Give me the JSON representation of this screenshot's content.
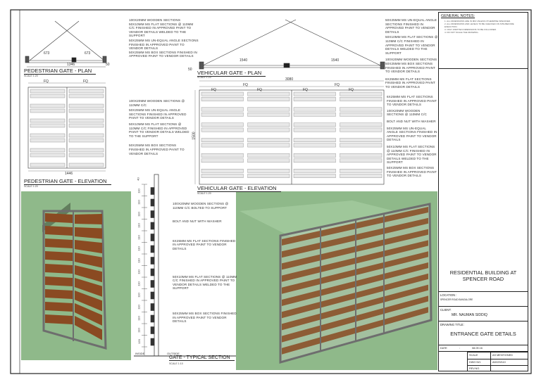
{
  "views": {
    "ped_plan": {
      "title": "PEDESTRIAN GATE - PLAN",
      "scale": "SCALE 1:20",
      "dims": [
        "673",
        "673",
        "1346",
        "50"
      ]
    },
    "veh_plan": {
      "title": "VEHICULAR GATE - PLAN",
      "scale": "SCALE 1:20",
      "dims": [
        "1540",
        "1540",
        "50"
      ]
    },
    "ped_elev": {
      "title": "PEDESTRIAN GATE - ELEVATION",
      "scale": "SCALE 1:20",
      "dims": [
        "FQ",
        "FQ",
        "1446"
      ]
    },
    "veh_elev": {
      "title": "VEHICULAR GATE - ELEVATION",
      "scale": "SCALE 1:20",
      "dims": [
        "3080",
        "FQ",
        "FQ",
        "FQ",
        "FQ",
        "FQ",
        "FQ",
        "1500"
      ]
    },
    "section": {
      "title": "GATE - TYPICAL SECTION",
      "scale": "SCALE 1:10",
      "inside": "INSIDE",
      "outside": "OUTSIDE",
      "dims": [
        "40",
        "110",
        "110",
        "110",
        "110",
        "110",
        "110",
        "110",
        "110",
        "110",
        "110",
        "110",
        "110",
        "110",
        "120"
      ]
    }
  },
  "notes": {
    "ped_plan": [
      "100X20MM WOODEN SECTIONS",
      "50X10MM MS FLAT SECTIONS @ 110MM C/C FINISHED IN APPROVED PAINT TO VENDOR DETAILS WELDED TO THE SUPPORT",
      "50X25MM MS UN-EQUAL ANGLE SECTIONS FINISHED IN APPROVED PAINT TO VENDOR DETAILS",
      "50X25MM MS BOX SECTIONS FINISHED IN APPROVED PAINT TO VENDOR DETAILS"
    ],
    "veh_plan": [
      "50X25MM MS UN-EQUAL ANGLE SECTIONS FINISHED IN APPROVED PAINT TO VENDOR DETAILS",
      "50X10MM MS FLAT SECTIONS @ 110MM C/C FINISHED IN APPROVED PAINT TO VENDOR DETAILS WELDED TO THE SUPPORT",
      "100X20MM WOODEN SECTIONS",
      "50X25MM MS BOX SECTIONS FINISHED IN APPROVED PAINT TO VENDOR DETAILS",
      "6X25MM MS FLAT SECTIONS FINISHED IN APPROVED PAINT TO VENDOR DETAILS"
    ],
    "ped_elev": [
      "100X20MM WOODEN SECTIONS @ 110MM C/C",
      "50X25MM MS UN-EQUAL ANGLE SECTIONS FINISHED IN APPROVED PAINT TO VENDOR DETAILS",
      "50X10MM MS FLAT SECTIONS @ 110MM C/C FINISHED IN APPROVED PAINT TO VENDOR DETAILS WELDED TO THE SUPPORT",
      "50X25MM MS BOX SECTIONS FINISHED IN APPROVED PAINT TO VENDOR DETAILS"
    ],
    "veh_elev": [
      "6X25MM MS FLAT SECTIONS FINISHED IN APPROVED PAINT TO VENDOR DETAILS",
      "100X20MM WOODEN SECTIONS @ 110MM C/C",
      "BOLT AND NUT WITH WASHER",
      "50X25MM MS UN-EQUAL ANGLE SECTIONS FINISHED IN APPROVED PAINT TO VENDOR DETAILS",
      "50X10MM MS FLAT SECTIONS @ 110MM C/C FINISHED IN APPROVED PAINT TO VENDOR DETAILS WELDED TO THE SUPPORT",
      "50X25MM MS BOX SECTIONS FINISHED IN APPROVED PAINT TO VENDOR DETAILS"
    ],
    "section": [
      "100X20MM WOODEN SECTIONS @ 110MM C/C BOLTED TO SUPPORT",
      "BOLT AND NUT WITH WASHER",
      "6X25MM MS FLAT SECTIONS FINISHED IN APPROVED PAINT TO VENDOR DETAILS",
      "50X10MM MS FLAT SECTIONS @ 110MM C/C FINISHED IN APPROVED PAINT TO VENDOR DETAILS WELDED TO THE SUPPORT",
      "50X25MM MS BOX SECTIONS FINISHED IN APPROVED PAINT TO VENDOR DETAILS"
    ]
  },
  "title_block": {
    "general_notes_title": "GENERAL NOTES:",
    "general_notes": [
      "1. ALL DIMENSIONS ARE IN MM UNLESS OTHERWISE SPECIFIED.",
      "2. ALL DIMENSIONS AND LEVELS TO BE CHECKED ON SITE BEFORE EXECUTION.",
      "3. ONLY WRITTEN DIMENSIONS TO BE FOLLOWED.",
      "4. DO NOT SCALE THE DRAWING."
    ],
    "project": "RESIDENTIAL BUILDING AT SPENCER ROAD",
    "location_label": "LOCATION :",
    "location": "SPENCER ROAD BANGALORE",
    "client_label": "CLIENT:",
    "client": "MR. NAUMAN SIDDIQ",
    "drawing_title_label": "DRAWING TITLE:",
    "drawing_title": "ENTRANCE GATE DETAILS",
    "date_label": "DATE",
    "date_sep": ":",
    "date": "08.09.16",
    "scale_label": "SCALE",
    "scale": "AS MENTIONED",
    "dwg_label": "DWG NO.",
    "dwg": "AD029/110",
    "rev_label": "REV.NO.",
    "rev": ""
  },
  "colors": {
    "render_bg": "#8fb98a",
    "wood": "#8a4a22",
    "steel": "#6e6e6e"
  }
}
